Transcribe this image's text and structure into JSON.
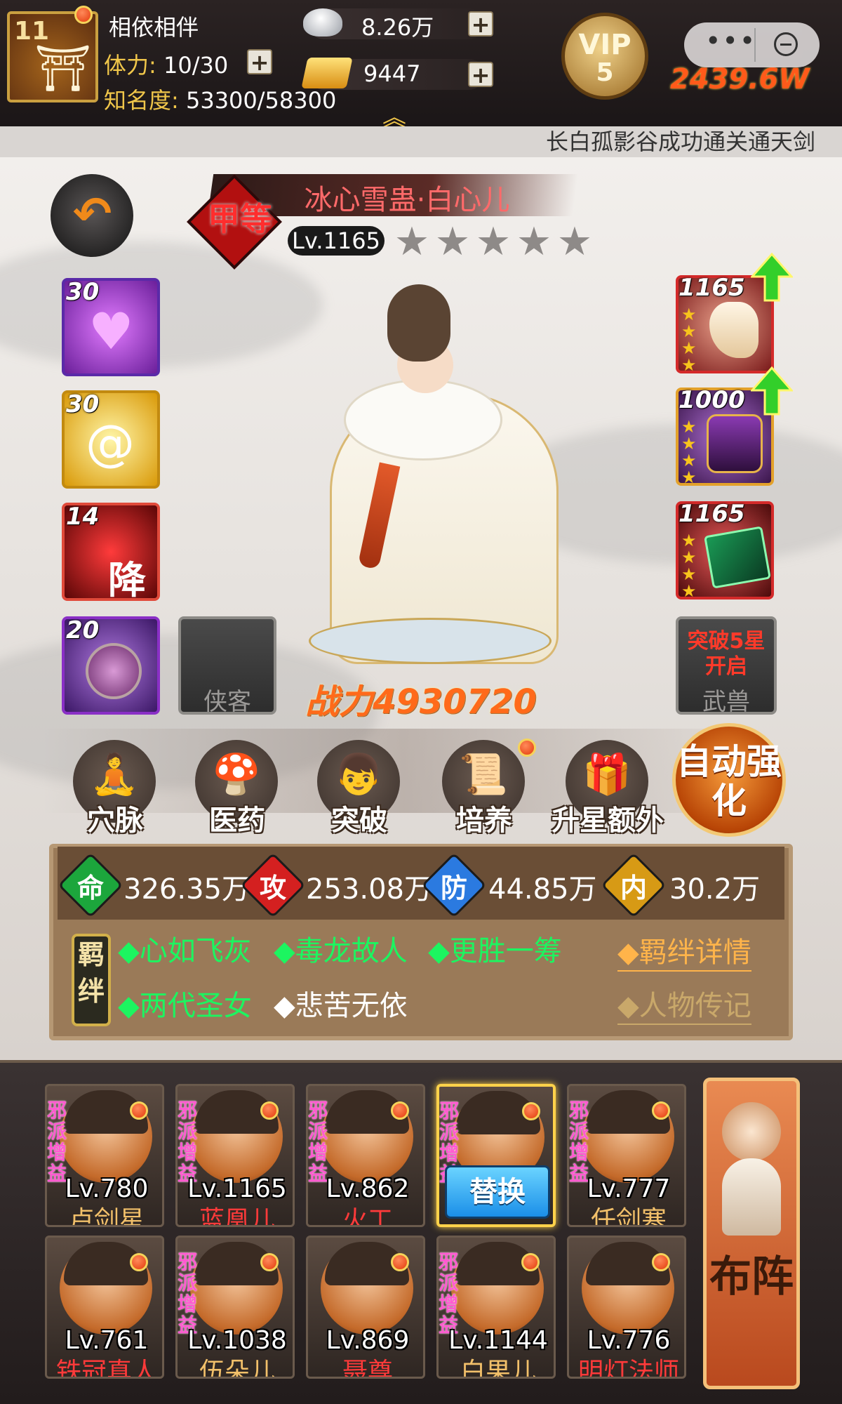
{
  "player": {
    "level": "11",
    "name": "相依相伴",
    "stamina_label": "体力:",
    "stamina_value": "10/30",
    "fame_label": "知名度:",
    "fame_value": "53300/58300"
  },
  "currency": {
    "silver": "8.26万",
    "gold": "9447"
  },
  "vip": {
    "label": "VIP",
    "level": "5"
  },
  "power_top": "2439.6W",
  "ticker": "长白孤影谷成功通关通天剑",
  "hero": {
    "grade": "甲等",
    "name": "冰心雪蛊·白心儿",
    "level": "Lv.1165",
    "stars": 5,
    "power": "战力4930720"
  },
  "skills": [
    {
      "level": "30",
      "icon": "heart-icon",
      "color": "#b04ee6"
    },
    {
      "level": "30",
      "icon": "swirl-icon",
      "color": "#e9b514"
    },
    {
      "level": "14",
      "icon": "descend-icon",
      "label": "降",
      "color": "#c41818"
    },
    {
      "level": "20",
      "icon": "orb-icon",
      "color": "#8a2fc6"
    }
  ],
  "equipment": [
    {
      "level": "1165",
      "icon": "shell-icon",
      "upgrade": true
    },
    {
      "level": "1000",
      "icon": "armor-icon",
      "upgrade": true
    },
    {
      "level": "1165",
      "icon": "book-icon",
      "upgrade": false
    }
  ],
  "slots": {
    "companion": "侠客",
    "beast": "武兽",
    "beast_lock": "突破5星开启"
  },
  "actions": [
    "穴脉",
    "医药",
    "突破",
    "培养",
    "升星额外"
  ],
  "auto_button": "自动强化",
  "stats": [
    {
      "icon": "命",
      "value": "326.35万",
      "color": "#1ca63c"
    },
    {
      "icon": "攻",
      "value": "253.08万",
      "color": "#d42020"
    },
    {
      "icon": "防",
      "value": "44.85万",
      "color": "#2b7ae0"
    },
    {
      "icon": "内",
      "value": "30.2万",
      "color": "#d79a15"
    }
  ],
  "fetters": {
    "tag": "羁绊",
    "row1": [
      "◆心如飞灰",
      "◆毒龙故人",
      "◆更胜一筹"
    ],
    "row2a": "◆两代圣女",
    "row2b": "◆悲苦无依",
    "detail": "◆羁绊详情",
    "bio": "◆人物传记"
  },
  "roster": [
    {
      "lv": "Lv.780",
      "name": "卢剑星",
      "tag": "邪派增益",
      "name_color": "#f2c06a"
    },
    {
      "lv": "Lv.1165",
      "name": "蓝凰儿",
      "tag": "邪派增益",
      "name_color": "#ff3a3a"
    },
    {
      "lv": "Lv.862",
      "name": "火工",
      "tag": "邪派增益",
      "name_color": "#ff3a3a"
    },
    {
      "lv": "",
      "name": "",
      "tag": "邪派增益",
      "swap": "替换",
      "name_color": "#ffffff"
    },
    {
      "lv": "Lv.777",
      "name": "任剑寒",
      "tag": "邪派增益",
      "name_color": "#f2c06a"
    },
    {
      "lv": "Lv.761",
      "name": "铁冠真人",
      "tag": "",
      "name_color": "#ff3a3a"
    },
    {
      "lv": "Lv.1038",
      "name": "伍朵儿",
      "tag": "邪派增益",
      "name_color": "#f2c06a"
    },
    {
      "lv": "Lv.869",
      "name": "聂尊",
      "tag": "",
      "name_color": "#ff3a3a"
    },
    {
      "lv": "Lv.1144",
      "name": "白果儿",
      "tag": "邪派增益",
      "name_color": "#f2c06a"
    },
    {
      "lv": "Lv.776",
      "name": "明灯法师",
      "tag": "",
      "name_color": "#ff3a3a"
    }
  ],
  "formation_button": "布阵"
}
